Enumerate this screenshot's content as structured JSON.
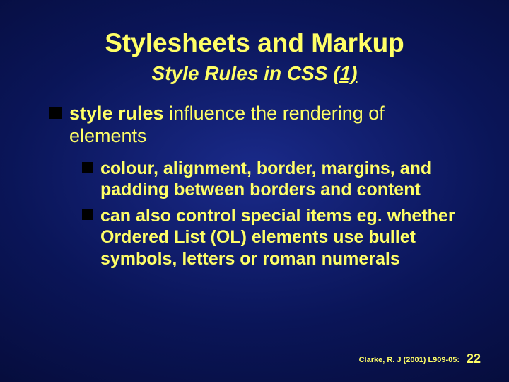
{
  "slide": {
    "title": "Stylesheets and Markup",
    "subtitle_plain": "Style Rules in CSS ",
    "subtitle_em": "(1)",
    "bullets_l1": {
      "lead": "style rules",
      "rest": " influence the rendering of elements"
    },
    "bullets_l2": [
      "colour, alignment, border, margins, and padding between borders and content",
      "can also control special items eg. whether Ordered List (OL) elements use bullet symbols, letters or roman numerals"
    ],
    "footer": {
      "attribution": "Clarke, R. J (2001) L909-05:",
      "page": "22"
    }
  }
}
